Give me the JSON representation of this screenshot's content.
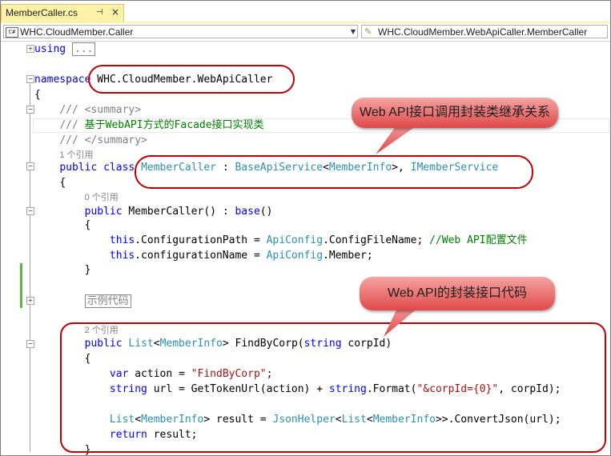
{
  "tab": {
    "title": "MemberCaller.cs",
    "pin": "⊣",
    "close": "×"
  },
  "nav": {
    "left_icon": "C#",
    "left_text": "WHC.CloudMember.Caller",
    "right_text": "WHC.CloudMember.WebApiCaller.MemberCaller"
  },
  "code": {
    "using_kw": "using",
    "using_collapsed": "...",
    "namespace_kw": "namespace",
    "namespace_name": "WHC.CloudMember.WebApiCaller",
    "brace_open": "{",
    "brace_close": "}",
    "doc1": "/// <summary>",
    "doc2_prefix": "/// ",
    "doc2_text": "基于WebAPI方式的Facade接口实现类",
    "doc3": "/// </summary>",
    "refs_1": "1 个引用",
    "class_public": "public",
    "class_kw": "class",
    "class_name": "MemberCaller",
    "class_colon": " : ",
    "base_type": "BaseApiService",
    "generic_open": "<",
    "member_info": "MemberInfo",
    "generic_close": ">, ",
    "interface": "IMemberService",
    "refs_0": "0 个引用",
    "ctor_public": "public",
    "ctor_sig": " MemberCaller() : ",
    "ctor_base": "base",
    "ctor_paren": "()",
    "this_kw": "this",
    "line1_mid": ".ConfigurationPath = ",
    "api_config": "ApiConfig",
    "line1_tail": ".ConfigFileName; ",
    "line1_comment": "//Web API配置文件",
    "line2_mid": ".configurationName = ",
    "line2_tail": ".Member;",
    "region_collapsed": "示例代码",
    "refs_2": "2 个引用",
    "m_public": "public",
    "m_list": "List",
    "m_sig": " FindByCorp(",
    "m_string": "string",
    "m_param": " corpId)",
    "var_kw": "var",
    "var_rest": " action = ",
    "str_findbycorp": "\"FindByCorp\"",
    "semi": ";",
    "url_type": "string",
    "url_mid": " url = GetTokenUrl(action) + ",
    "url_string": "string",
    "url_format": ".Format(",
    "str_corpid": "\"&corpId={0}\"",
    "url_tail": ", corpId);",
    "result_list": "List",
    "result_mid": " result = ",
    "json_helper": "JsonHelper",
    "result_tail": ">>.ConvertJson(url);",
    "return_kw": "return",
    "return_rest": " result;"
  },
  "annotations": {
    "bubble1": "Web API接口调用封装类继承关系",
    "bubble2": "Web API的封装接口代码"
  },
  "colors": {
    "keyword": "#0000ff",
    "type": "#2b91af",
    "comment": "#008000",
    "string": "#a31515",
    "callout": "#c00000"
  }
}
